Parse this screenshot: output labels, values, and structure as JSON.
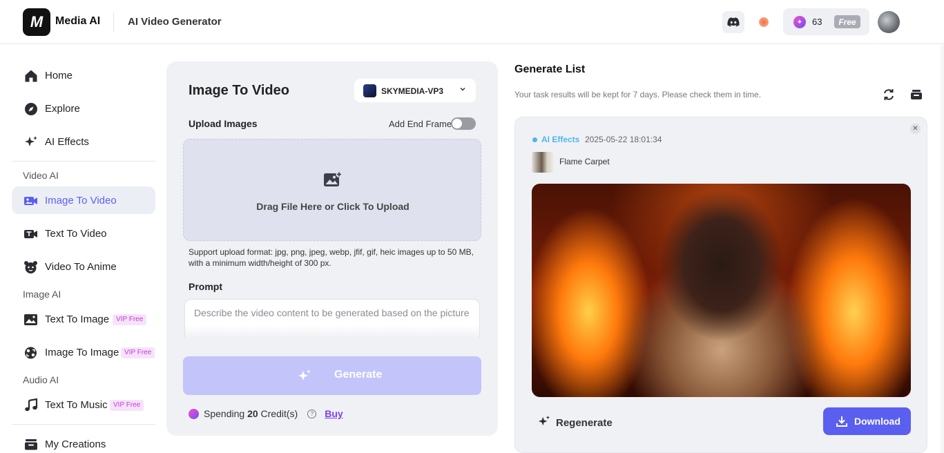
{
  "header": {
    "logo_text": "M",
    "brand": "Media AI",
    "page_title": "AI Video Generator",
    "credits": "63",
    "plan": "Free"
  },
  "sidebar": {
    "top_items": [
      {
        "label": "Home",
        "icon": "home-icon"
      },
      {
        "label": "Explore",
        "icon": "compass-icon"
      },
      {
        "label": "AI Effects",
        "icon": "sparkle-icon"
      }
    ],
    "sections": [
      {
        "title": "Video AI",
        "items": [
          {
            "label": "Image To Video",
            "active": true
          },
          {
            "label": "Text To Video"
          },
          {
            "label": "Video To Anime"
          }
        ]
      },
      {
        "title": "Image AI",
        "items": [
          {
            "label": "Text To Image",
            "badge": "VIP Free"
          },
          {
            "label": "Image To Image",
            "badge": "VIP Free"
          }
        ]
      },
      {
        "title": "Audio AI",
        "items": [
          {
            "label": "Text To Music",
            "badge": "VIP Free"
          }
        ]
      }
    ],
    "bottom_items": [
      {
        "label": "My Creations"
      }
    ]
  },
  "panel": {
    "title": "Image To Video",
    "model": "SKYMEDIA-VP3",
    "upload_label": "Upload Images",
    "end_frame_label": "Add End Frame",
    "end_frame_enabled": false,
    "dropzone_text": "Drag File Here or Click To Upload",
    "support_text": "Support upload format: jpg, png, jpeg, webp, jfif, gif, heic images up to 50 MB, with a minimum width/height of 300 px.",
    "prompt_label": "Prompt",
    "prompt_placeholder": "Describe the video content to be generated based on the picture",
    "generate_label": "Generate",
    "spend_prefix": "Spending",
    "spend_amount": "20",
    "spend_suffix": "Credit(s)",
    "buy_label": "Buy"
  },
  "generate_list": {
    "title": "Generate List",
    "subtitle": "Your task results will be kept for 7 days. Please check them in time.",
    "card": {
      "tag": "AI Effects",
      "timestamp": "2025-05-22 18:01:34",
      "effect_name": "Flame Carpet",
      "regenerate_label": "Regenerate",
      "download_label": "Download"
    }
  },
  "colors": {
    "accent": "#5b5ff0",
    "generate_disabled": "#c3c4fa",
    "tag": "#4fb4f0",
    "vip_badge_text": "#c23bd6"
  }
}
